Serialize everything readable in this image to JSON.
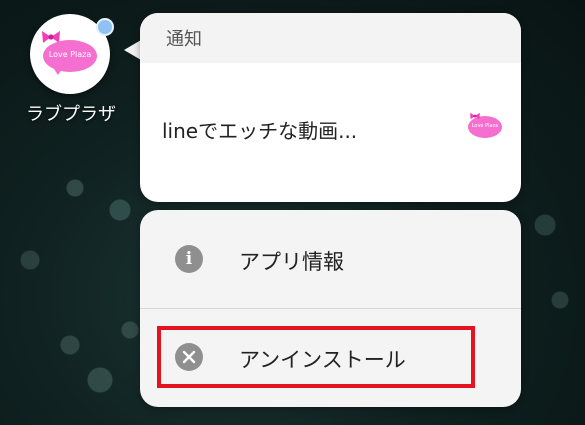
{
  "app": {
    "name": "ラブプラザ",
    "logo_text": "Love Plaza",
    "icon_name": "love-plaza-app-icon",
    "badge": "notification-dot"
  },
  "notification": {
    "header": "通知",
    "message": "lineでエッチな動画...",
    "thumbnail_text": "Love Plaza"
  },
  "menu": {
    "items": [
      {
        "label": "アプリ情報",
        "icon": "info-icon"
      },
      {
        "label": "アンインストール",
        "icon": "uninstall-x-icon"
      }
    ]
  },
  "colors": {
    "brand_pink": "#f46fd0",
    "badge_blue": "#8fc1f2",
    "highlight_red": "#e3141f",
    "menu_icon_gray": "#8f8f8f"
  }
}
